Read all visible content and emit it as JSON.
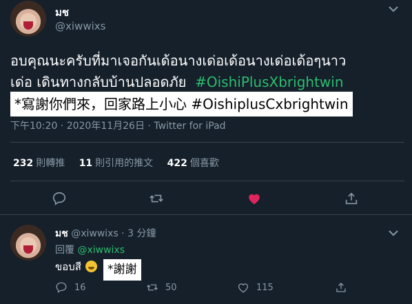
{
  "main_tweet": {
    "display_name": "มช",
    "handle": "@xiwwixs",
    "text_line1": "อบคุณนะครับที่มาเจอกันเด้อนางเด่อเด้อนางเด่อเด้อๆนาว",
    "text_line2": "เด่อ เดินทางกลับบ้านปลอดภัย",
    "hashtag": "#OishiPlusXbrightwin",
    "translation": "*寫謝你們來，回家路上小心 #OishiplusCxbrightwin",
    "timestamp": "下午10:20 · 2020年11月26日 · Twitter for iPad",
    "stats": {
      "retweets_count": "232",
      "retweets_label": "則轉推",
      "quotes_count": "11",
      "quotes_label": "則引用的推文",
      "likes_count": "422",
      "likes_label": "個喜歡"
    }
  },
  "reply_tweet": {
    "display_name": "มช",
    "handle_time": "@xiwwixs · 3 分鐘",
    "replying_label": "回覆",
    "replying_to": "@xiwwixs",
    "text": "ขอบสี",
    "translation": "*謝謝",
    "counts": {
      "replies": "16",
      "retweets": "50",
      "likes": "115"
    }
  },
  "colors": {
    "background": "#15202b",
    "muted": "#8899a6",
    "hashtag": "#2dbd6e",
    "like_active": "#e0245e",
    "divider": "#38444d"
  },
  "icons": [
    "more-icon",
    "reply-icon",
    "retweet-icon",
    "like-icon",
    "share-icon"
  ]
}
